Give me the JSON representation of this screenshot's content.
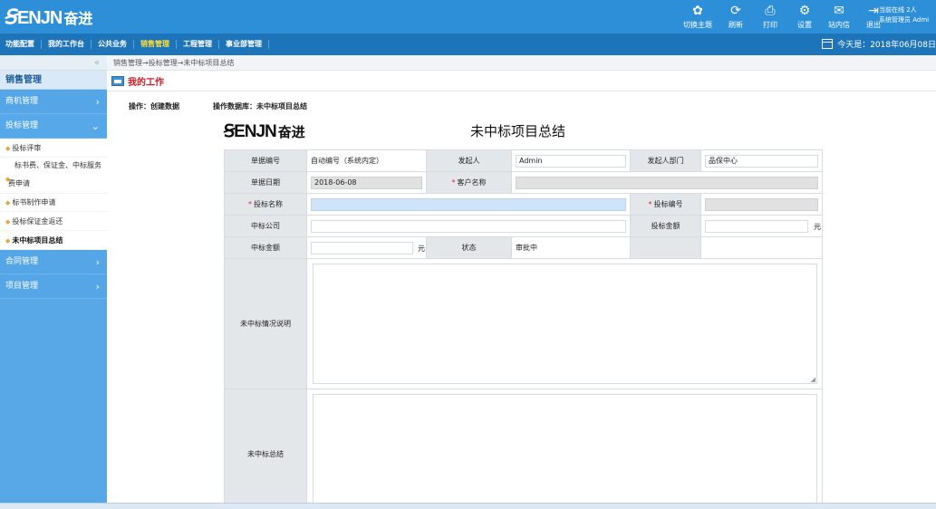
{
  "header": {
    "logo_text": "ENJN",
    "logo_cn": "奋进",
    "actions": [
      {
        "icon": "palette-icon",
        "label": "切换主题"
      },
      {
        "icon": "refresh-icon",
        "label": "刷新"
      },
      {
        "icon": "print-icon",
        "label": "打印"
      },
      {
        "icon": "gear-icon",
        "label": "设置"
      },
      {
        "icon": "mail-icon",
        "label": "站内信"
      },
      {
        "icon": "logout-icon",
        "label": "退出"
      }
    ],
    "online_line1": "当前在线 2人",
    "online_line2": "系统管理员 Admi"
  },
  "menu": {
    "items": [
      "功能配置",
      "我的工作台",
      "公共业务",
      "销售管理",
      "工程管理",
      "事业部管理"
    ],
    "active": "销售管理",
    "today": "今天是：2018年06月08日"
  },
  "sidebar": {
    "collapse": "«",
    "title": "销售管理",
    "groups": [
      {
        "label": "商机管理"
      },
      {
        "label": "投标管理"
      }
    ],
    "subitems": [
      {
        "label": "投标评审"
      },
      {
        "label1": "标书费、保证金、中标服务",
        "label2": "费申请"
      },
      {
        "label": "标书制作申请"
      },
      {
        "label": "投标保证金返还"
      },
      {
        "label": "未中标项目总结"
      }
    ],
    "groups_after": [
      {
        "label": "合同管理"
      },
      {
        "label": "项目管理"
      }
    ]
  },
  "breadcrumb": "销售管理→投标管理→未中标项目总结",
  "work_title": "我的工作",
  "operation": "操作：创建数据",
  "database": "操作数据库：未中标项目总结",
  "form": {
    "logo_text": "ENJN",
    "logo_cn": "奋进",
    "title": "未中标项目总结",
    "labels": {
      "doc_no": "单据编号",
      "initiator": "发起人",
      "dept": "发起人部门",
      "doc_date": "单据日期",
      "customer": "客户名称",
      "bid_name": "投标名称",
      "bid_no": "投标编号",
      "winner": "中标公司",
      "bid_amount": "投标金额",
      "win_amount": "中标金额",
      "status": "状态",
      "situation": "未中标情况说明",
      "summary": "未中标总结"
    },
    "values": {
      "doc_no": "自动编号（系统内定）",
      "initiator": "Admin",
      "dept": "品保中心",
      "doc_date": "2018-06-08",
      "status": "审批中"
    },
    "unit": "元"
  }
}
